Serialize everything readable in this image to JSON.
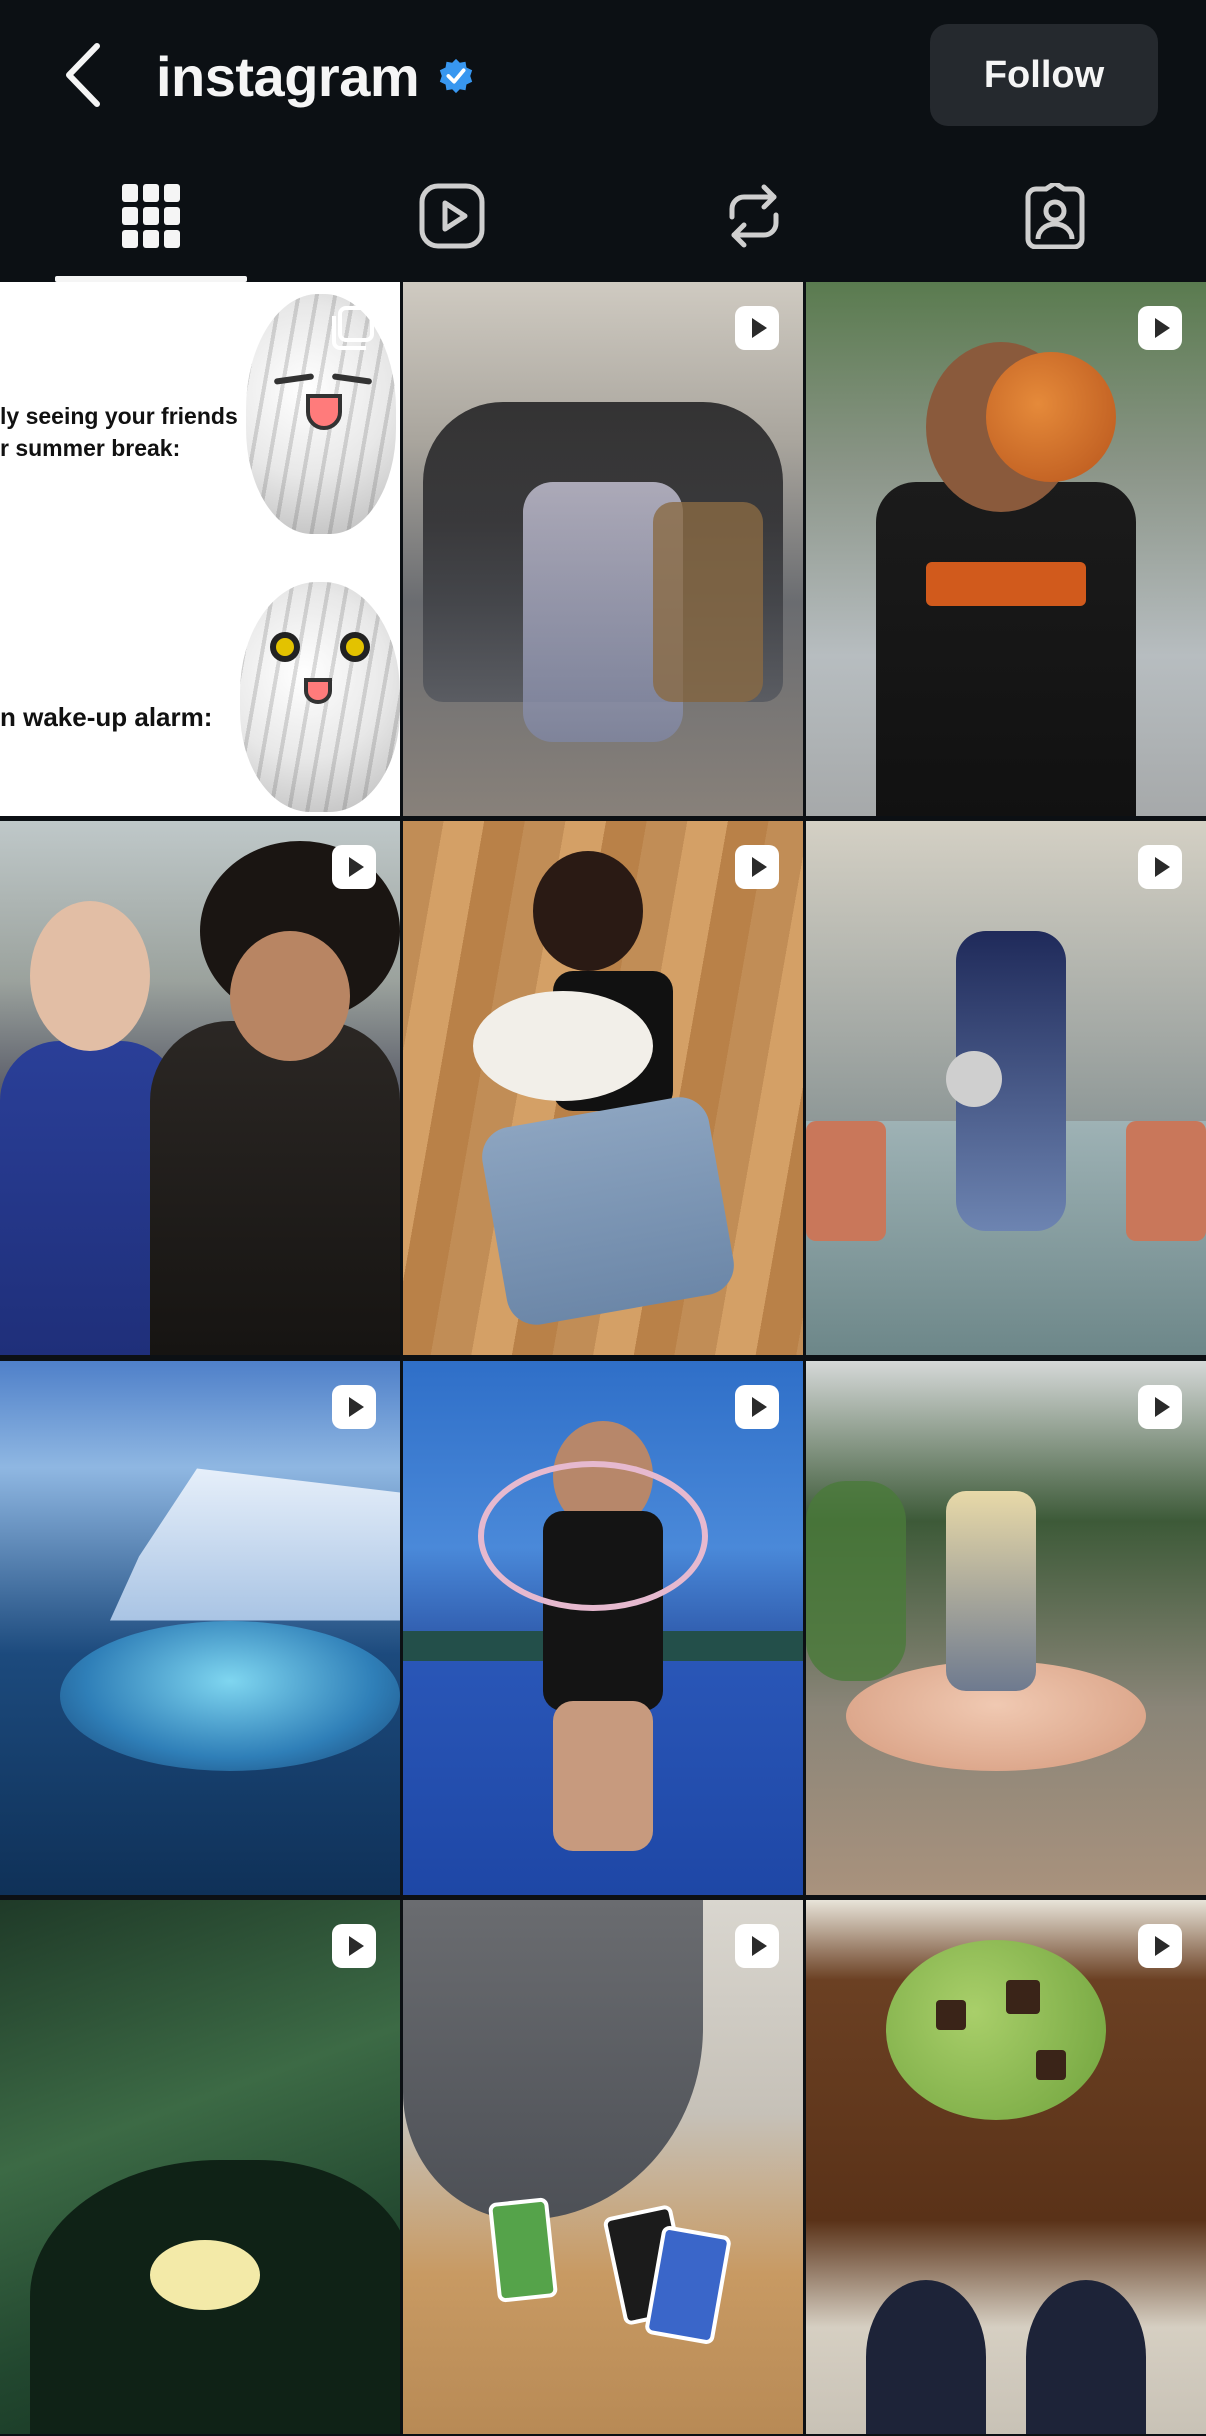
{
  "header": {
    "title": "instagram",
    "follow_label": "Follow",
    "verified_icon": "verified-badge-icon",
    "back_icon": "chevron-left-icon",
    "accent_color": "#3897f0"
  },
  "tabs": [
    {
      "name": "posts-grid",
      "icon": "grid-icon",
      "active": true
    },
    {
      "name": "reels",
      "icon": "reels-icon",
      "active": false
    },
    {
      "name": "reposts",
      "icon": "repost-icon",
      "active": false
    },
    {
      "name": "tagged",
      "icon": "tagged-person-icon",
      "active": false
    }
  ],
  "grid": {
    "tiles": [
      {
        "kind": "carousel",
        "caption_top": "ly seeing your friends\nr summer break:",
        "caption_bottom": "n wake-up alarm:"
      },
      {
        "kind": "reel"
      },
      {
        "kind": "reel"
      },
      {
        "kind": "reel"
      },
      {
        "kind": "reel"
      },
      {
        "kind": "reel"
      },
      {
        "kind": "reel"
      },
      {
        "kind": "reel"
      },
      {
        "kind": "reel"
      },
      {
        "kind": "reel"
      },
      {
        "kind": "reel"
      },
      {
        "kind": "reel"
      }
    ]
  }
}
